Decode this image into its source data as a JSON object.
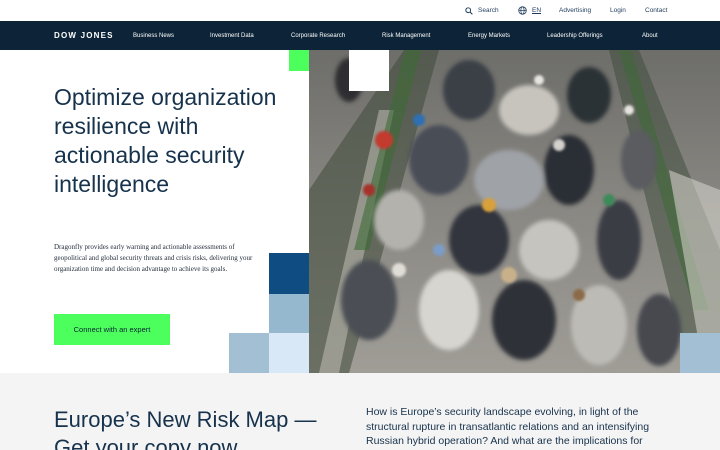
{
  "utility": {
    "search_label": "Search",
    "language_label": "EN",
    "advertising_label": "Advertising",
    "login_label": "Login",
    "contact_label": "Contact"
  },
  "nav": {
    "logo": "DOW JONES",
    "items": [
      {
        "label": "Business News"
      },
      {
        "label": "Investment Data"
      },
      {
        "label": "Corporate Research"
      },
      {
        "label": "Risk Management"
      },
      {
        "label": "Energy Markets"
      },
      {
        "label": "Leadership Offerings"
      },
      {
        "label": "About"
      }
    ]
  },
  "hero": {
    "title": "Optimize organization resilience with actionable security intelligence",
    "description": "Dragonfly provides early warning and actionable assessments of geopolitical and global security threats and crisis risks, delivering your organization time and decision advantage to achieve its goals.",
    "cta_label": "Connect with an expert"
  },
  "promo": {
    "title": "Europe’s New Risk Map — Get your copy now",
    "text": "How is Europe’s security landscape evolving, in light of the structural rupture in transatlantic relations and an intensifying Russian hybrid operation? And what are the implications for"
  },
  "colors": {
    "navy": "#0d2438",
    "accent_green": "#4cff5c",
    "title_blue": "#17324c",
    "tile_dark": "#0f4c81",
    "tile_mid": "#96b8cf",
    "tile_light": "#d8e8f6"
  },
  "icons": {
    "search": "search-icon",
    "language": "globe-icon"
  }
}
